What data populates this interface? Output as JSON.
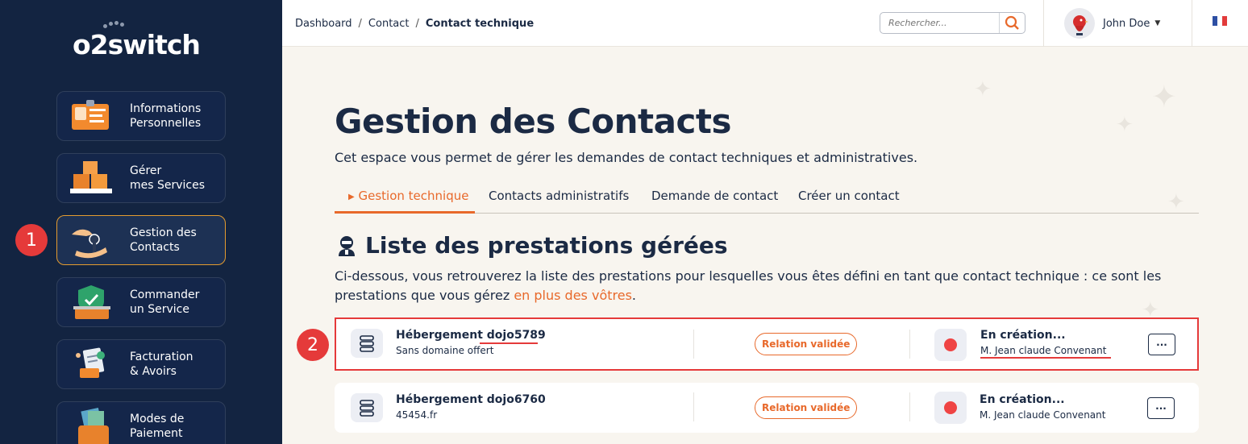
{
  "sidebar": {
    "logo": "o2switch",
    "items": [
      {
        "label": "Informations\nPersonnelles"
      },
      {
        "label": "Gérer\nmes Services"
      },
      {
        "label": "Gestion des\nContacts"
      },
      {
        "label": "Commander\nun Service"
      },
      {
        "label": "Facturation\n& Avoirs"
      },
      {
        "label": "Modes de\nPaiement"
      }
    ],
    "annotation": "1"
  },
  "topbar": {
    "breadcrumb": [
      "Dashboard",
      "Contact",
      "Contact technique"
    ],
    "breadcrumb_sep": "/",
    "search_placeholder": "Rechercher...",
    "user_name": "John Doe"
  },
  "main": {
    "title": "Gestion des Contacts",
    "subtitle": "Cet espace vous permet de gérer les demandes de contact techniques et administratives.",
    "tabs": [
      {
        "label": "Gestion technique",
        "active": true
      },
      {
        "label": "Contacts administratifs"
      },
      {
        "label": "Demande de contact"
      },
      {
        "label": "Créer un contact"
      }
    ],
    "section_title": "Liste des prestations gérées",
    "description_main": "Ci-dessous, vous retrouverez la liste des prestations pour lesquelles vous êtes défini en tant que contact technique : ce sont les prestations que vous gérez ",
    "description_accent": "en plus des vôtres",
    "description_end": ".",
    "annotation": "2",
    "services": [
      {
        "name_prefix": "Hébergement ",
        "name_id": "dojo5789",
        "subtitle": "Sans domaine offert",
        "relation": "Relation validée",
        "status": "En création...",
        "contact": "M. Jean claude Convenant",
        "more": "···"
      },
      {
        "name_prefix": "Hébergement ",
        "name_id": "dojo6760",
        "subtitle": "45454.fr",
        "relation": "Relation validée",
        "status": "En création...",
        "contact": "M. Jean claude Convenant",
        "more": "···"
      }
    ]
  },
  "colors": {
    "sidebar_bg": "#132441",
    "accent": "#e8692b",
    "annotation_red": "#e53a3a",
    "page_bg": "#f8f5ef"
  }
}
